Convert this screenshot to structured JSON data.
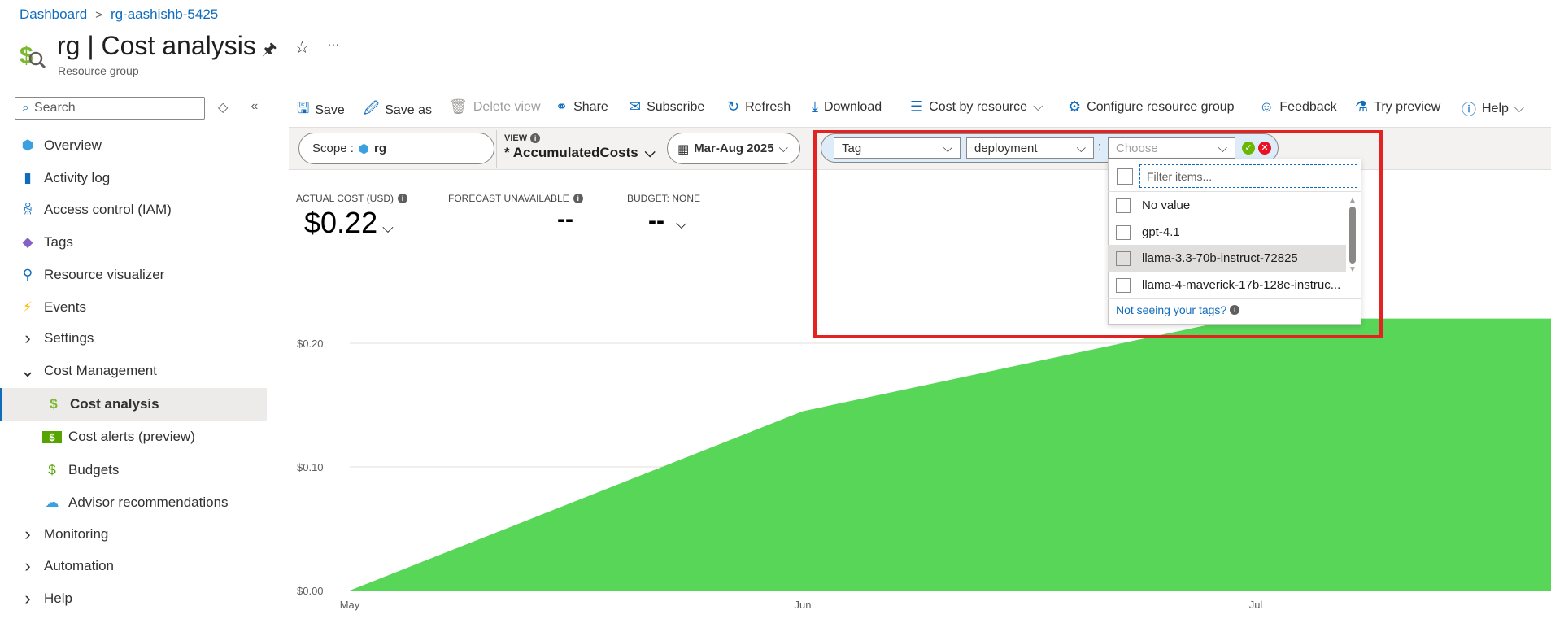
{
  "breadcrumb": [
    "Dashboard",
    "rg-aashishb-5425"
  ],
  "header": {
    "title": "rg | Cost analysis",
    "subtitle": "Resource group",
    "more": "···"
  },
  "sidebar": {
    "search_placeholder": "Search",
    "items": [
      {
        "label": "Overview",
        "icon": "resource-group-icon"
      },
      {
        "label": "Activity log",
        "icon": "activity-log-icon"
      },
      {
        "label": "Access control (IAM)",
        "icon": "people-icon"
      },
      {
        "label": "Tags",
        "icon": "tag-icon"
      },
      {
        "label": "Resource visualizer",
        "icon": "hierarchy-icon"
      },
      {
        "label": "Events",
        "icon": "lightning-icon"
      },
      {
        "label": "Settings",
        "icon": "chevron-right-icon"
      },
      {
        "label": "Cost Management",
        "icon": "chevron-down-icon"
      },
      {
        "label": "Cost analysis",
        "icon": "cost-analysis-icon",
        "selected": true
      },
      {
        "label": "Cost alerts (preview)",
        "icon": "cost-alert-icon"
      },
      {
        "label": "Budgets",
        "icon": "budget-icon"
      },
      {
        "label": "Advisor recommendations",
        "icon": "advisor-icon"
      },
      {
        "label": "Monitoring",
        "icon": "chevron-right-icon"
      },
      {
        "label": "Automation",
        "icon": "chevron-right-icon"
      },
      {
        "label": "Help",
        "icon": "chevron-right-icon"
      }
    ]
  },
  "toolbar": {
    "save": "Save",
    "save_as": "Save as",
    "delete_view": "Delete view",
    "share": "Share",
    "subscribe": "Subscribe",
    "refresh": "Refresh",
    "download": "Download",
    "cost_by_resource": "Cost by resource",
    "configure": "Configure resource group",
    "feedback": "Feedback",
    "try_preview": "Try preview",
    "help": "Help"
  },
  "filters": {
    "scope_label": "Scope :",
    "scope_value": "rg",
    "view_label": "VIEW",
    "view_value": "* AccumulatedCosts",
    "date_range": "Mar-Aug 2025",
    "filter_type": "Tag",
    "tag_key": "deployment",
    "tag_value_placeholder": "Choose"
  },
  "dropdown": {
    "filter_placeholder": "Filter items...",
    "items": [
      "No value",
      "gpt-4.1",
      "llama-3.3-70b-instruct-72825",
      "llama-4-maverick-17b-128e-instruc..."
    ],
    "highlighted_index": 2,
    "help_link": "Not seeing your tags?"
  },
  "kpis": {
    "actual_label": "ACTUAL COST (USD)",
    "actual_value": "$0.22",
    "forecast_label": "FORECAST UNAVAILABLE",
    "forecast_value": "--",
    "budget_label": "BUDGET: NONE",
    "budget_value": "--"
  },
  "colors": {
    "accent": "#0f6cbd",
    "area": "#57d657",
    "highlight": "#e32222"
  },
  "chart_data": {
    "type": "area",
    "title": "Accumulated cost",
    "xlabel": "",
    "ylabel": "",
    "x_ticks": [
      "May",
      "Jun",
      "Jul"
    ],
    "y_ticks": [
      "$0.00",
      "$0.10",
      "$0.20"
    ],
    "ylim": [
      0,
      0.25
    ],
    "series": [
      {
        "name": "Accumulated cost",
        "points": [
          {
            "x": 0,
            "y": 0
          },
          {
            "x": 1,
            "y": 0.145
          },
          {
            "x": 1.96,
            "y": 0.22
          },
          {
            "x": 2.7,
            "y": 0.22
          }
        ]
      }
    ],
    "grid": true
  }
}
